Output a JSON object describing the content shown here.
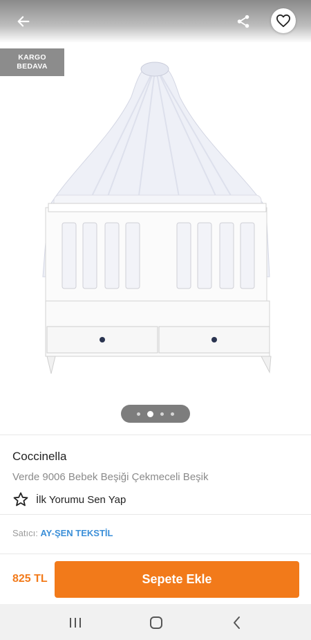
{
  "header": {
    "back_icon": "arrow-left-icon",
    "share_icon": "share-icon",
    "favorite_icon": "heart-outline-icon"
  },
  "gallery": {
    "badge_line1": "KARGO",
    "badge_line2": "BEDAVA",
    "image_description_icon": "crib-image",
    "page_count": 4,
    "active_page": 2
  },
  "product": {
    "brand": "Coccinella",
    "name": "Verde 9006 Bebek Beşiği Çekmeceli Beşik",
    "review_label": "İlk Yorumu Sen Yap",
    "review_icon": "star-outline-icon"
  },
  "seller": {
    "label": "Satıcı: ",
    "name": "AY-ŞEN TEKSTİL"
  },
  "purchase": {
    "price": "825 TL",
    "add_to_cart": "Sepete Ekle"
  },
  "colors": {
    "accent": "#f27a1a",
    "seller_link": "#3b8fd8"
  },
  "system_nav": {
    "recent_icon": "recent-apps-icon",
    "home_icon": "home-icon",
    "back_icon": "back-chevron-icon"
  }
}
